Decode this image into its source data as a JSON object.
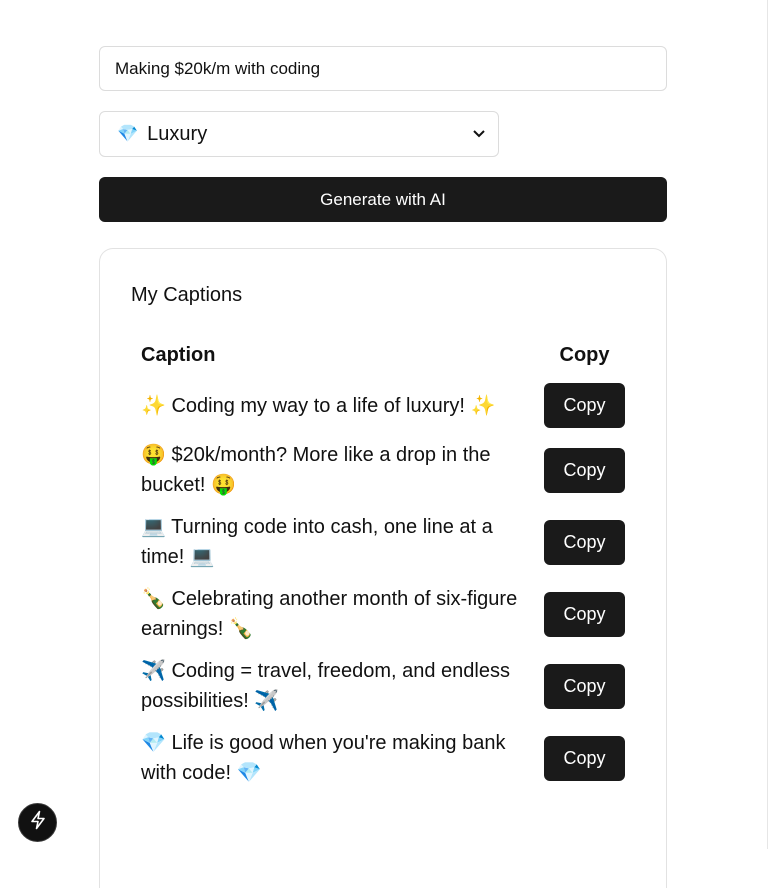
{
  "form": {
    "topic_value": "Making $20k/m with coding",
    "style_select": {
      "emoji": "💎",
      "selected": "Luxury"
    },
    "generate_label": "Generate with AI"
  },
  "captions": {
    "title": "My Captions",
    "headers": {
      "caption": "Caption",
      "copy": "Copy"
    },
    "items": [
      {
        "text": "✨ Coding my way to a life of luxury! ✨",
        "button": "Copy"
      },
      {
        "text": "🤑 $20k/month? More like a drop in the bucket! 🤑",
        "button": "Copy"
      },
      {
        "text": "💻 Turning code into cash, one line at a time! 💻",
        "button": "Copy"
      },
      {
        "text": "🍾 Celebrating another month of six-figure earnings! 🍾",
        "button": "Copy"
      },
      {
        "text": "✈️ Coding = travel, freedom, and endless possibilities! ✈️",
        "button": "Copy"
      },
      {
        "text": "💎 Life is good when you're making bank with code! 💎",
        "button": "Copy"
      }
    ]
  },
  "devtools": {
    "icon": "lightning-bolt-icon"
  }
}
